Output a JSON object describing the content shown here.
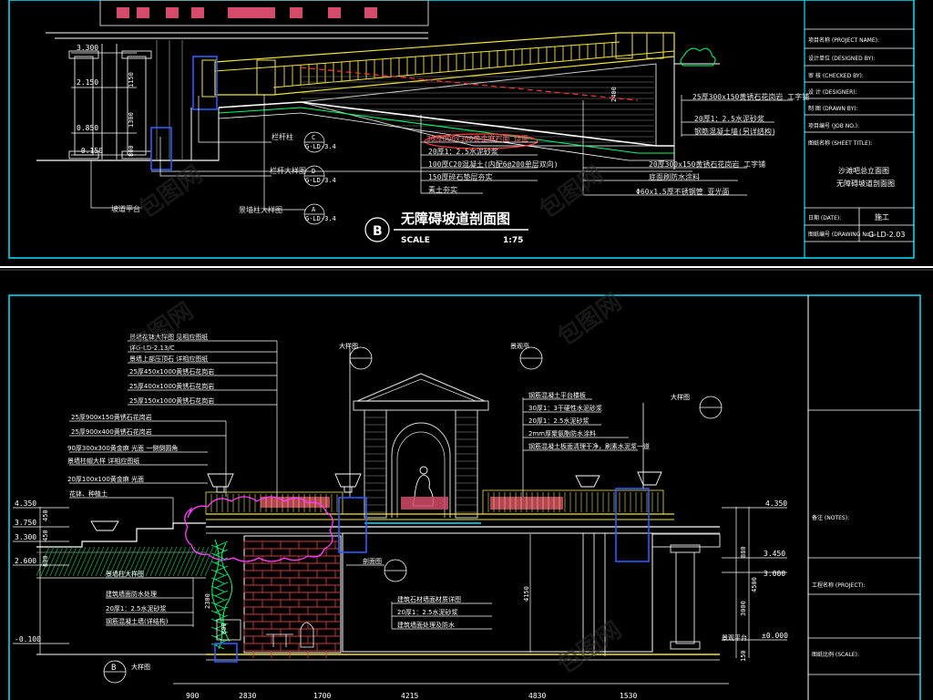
{
  "top_drawing": {
    "title": "无障碍坡道剖面图",
    "badge": "B",
    "scale_label": "SCALE",
    "scale_value": "1:75",
    "elevations": [
      "3.300",
      "2.150",
      "0.850",
      "-0.150"
    ],
    "dims_vertical": [
      "1150",
      "1300",
      "800",
      "2400"
    ],
    "callouts_left": [
      "栏杆柱",
      "栏杆大样图",
      "坡道平台",
      "景墙柱大样图"
    ],
    "callouts_mid": [
      "30厚800x300黄金麻石面 烧面",
      "20厚1：2.5水泥砂浆",
      "100厚C20混凝土(内配6@200单层双向)",
      "150厚碎石垫层夯实",
      "素土夯实"
    ],
    "callouts_right": [
      "25厚300x150黄锈石花岗岩 工字铺",
      "20厚1：2.5水泥砂浆",
      "钢筋混凝土墙(另详结构)",
      "20厚300x150黄锈石花岗岩 工字铺",
      "底面刷防水涂料",
      "Φ60x1.5厚不锈钢管 亚光面"
    ],
    "detail_refs": [
      {
        "top": "C",
        "bottom": "G-LD-3.4"
      },
      {
        "top": "D",
        "bottom": "G-LD-3.4"
      },
      {
        "top": "A",
        "bottom": "G-LD-3.4"
      }
    ]
  },
  "top_title_block": {
    "rows": [
      "项目名称 (PROJECT NAME):",
      "设计单位 (DESIGNED BY):",
      "审 核 (CHECKED BY):",
      "设 计 (DESIGNER):",
      "制 图 (DRAWN BY):",
      "项目编号 (JOB NO.):",
      "图纸名称 (SHEET TITLE):"
    ],
    "sheet_title_1": "沙滩吧总立面图",
    "sheet_title_2": "无障碍坡道剖面图",
    "date_label": "日期 (DATE):",
    "drawing_no_label": "图纸编号 (DRAWING No.):",
    "stage": "施工",
    "drawing_no": "G-LD-2.03"
  },
  "bottom_drawing": {
    "elevations_left": [
      "4.350",
      "3.750",
      "3.300",
      "2.600",
      "-0.100"
    ],
    "elevations_right": [
      "4.350",
      "3.450",
      "3.000",
      "±0.000"
    ],
    "dims_vertical": [
      "450",
      "450",
      "800",
      "2300",
      "800",
      "4150",
      "3000",
      "4500",
      "880",
      "150"
    ],
    "callouts_top_left": [
      "景墙花钵大样图  见相应图纸",
      "详G-LD-2.13/C",
      "景墙上部压顶石  详相应图纸",
      "25厚450x1000黄锈石花岗岩",
      "25厚400x1000黄锈石花岗岩",
      "25厚150x1000黄锈石花岗岩",
      "25厚900x150黄锈石花岗岩",
      "25厚900x400黄锈石花岗岩",
      "90厚300x300黄金麻 光面  一侧倒圆角",
      "景墙柱帽大样  详相应图纸",
      "20厚100x100黄金麻 光面",
      "花钵、种植土"
    ],
    "callouts_lower_left": [
      "景墙柱大样图",
      "建筑墙面防水处理",
      "20厚1：2.5水泥砂浆",
      "钢筋混凝土墙(详结构)"
    ],
    "callouts_center": [
      "建筑石材墙面材质详图",
      "20厚1：2.5水泥砂浆",
      "建筑墙面处理及防水"
    ],
    "callouts_right": [
      "钢筋混凝土平台楼板",
      "30厚1：3干硬性水泥砂浆",
      "20厚1：2.5水泥砂浆",
      "2mm厚聚氨酯防水涂料",
      "钢筋混凝土板面清理干净，刷素水泥浆一道"
    ],
    "labels": [
      "大样图",
      "景观亭",
      "大样图",
      "剖面图",
      "景观平台",
      "大样图"
    ],
    "dims_bottom": [
      "900",
      "2830",
      "1700",
      "4215",
      "4830",
      "1530"
    ],
    "section_badge": "B"
  },
  "bottom_title_block": {
    "rows": [
      "备注 (NOTES):",
      "工程名称 (PROJECT):",
      "图纸比例 (SCALE):"
    ]
  },
  "watermark": "包图网"
}
